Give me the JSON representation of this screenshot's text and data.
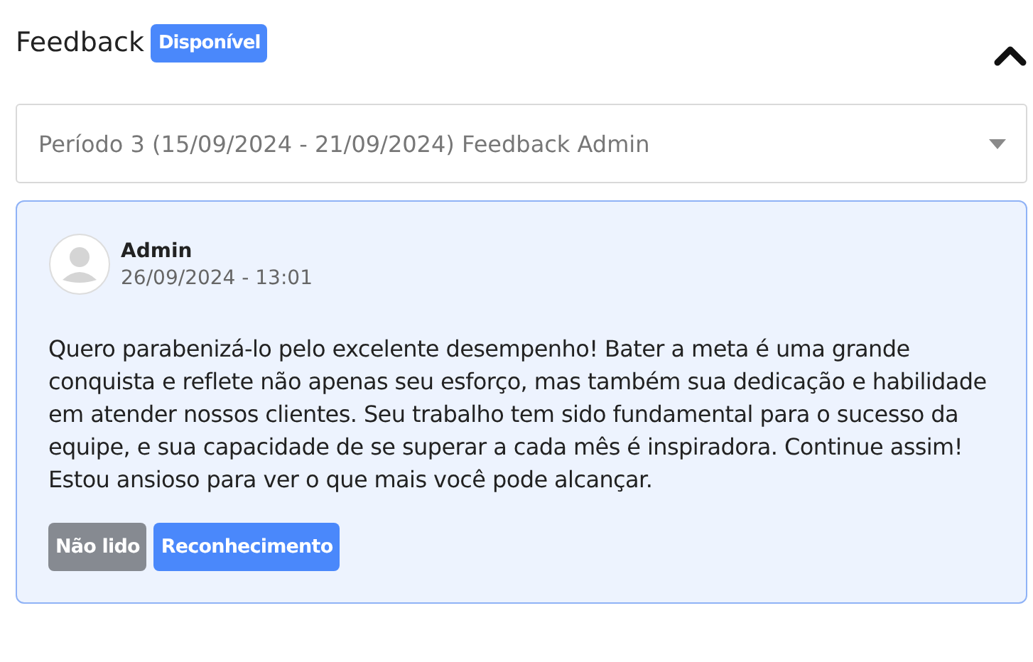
{
  "header": {
    "title": "Feedback",
    "badge": "Disponível",
    "expanded": true
  },
  "period_select": {
    "value": "Período 3 (15/09/2024 - 21/09/2024) Feedback Admin"
  },
  "feedback": {
    "author": "Admin",
    "datetime": "26/09/2024 - 13:01",
    "message": "Quero parabenizá-lo pelo excelente desempenho! Bater a meta é uma grande conquista e reflete não apenas seu esforço, mas também sua dedicação e habilidade em atender nossos clientes. Seu trabalho tem sido fundamental para o sucesso da equipe, e sua capacidade de se superar a cada mês é inspiradora. Continue assim! Estou ansioso para ver o que mais você pode alcançar.",
    "tags": [
      {
        "label": "Não lido",
        "color": "#868a91"
      },
      {
        "label": "Reconhecimento",
        "color": "#4a88fb"
      }
    ]
  }
}
